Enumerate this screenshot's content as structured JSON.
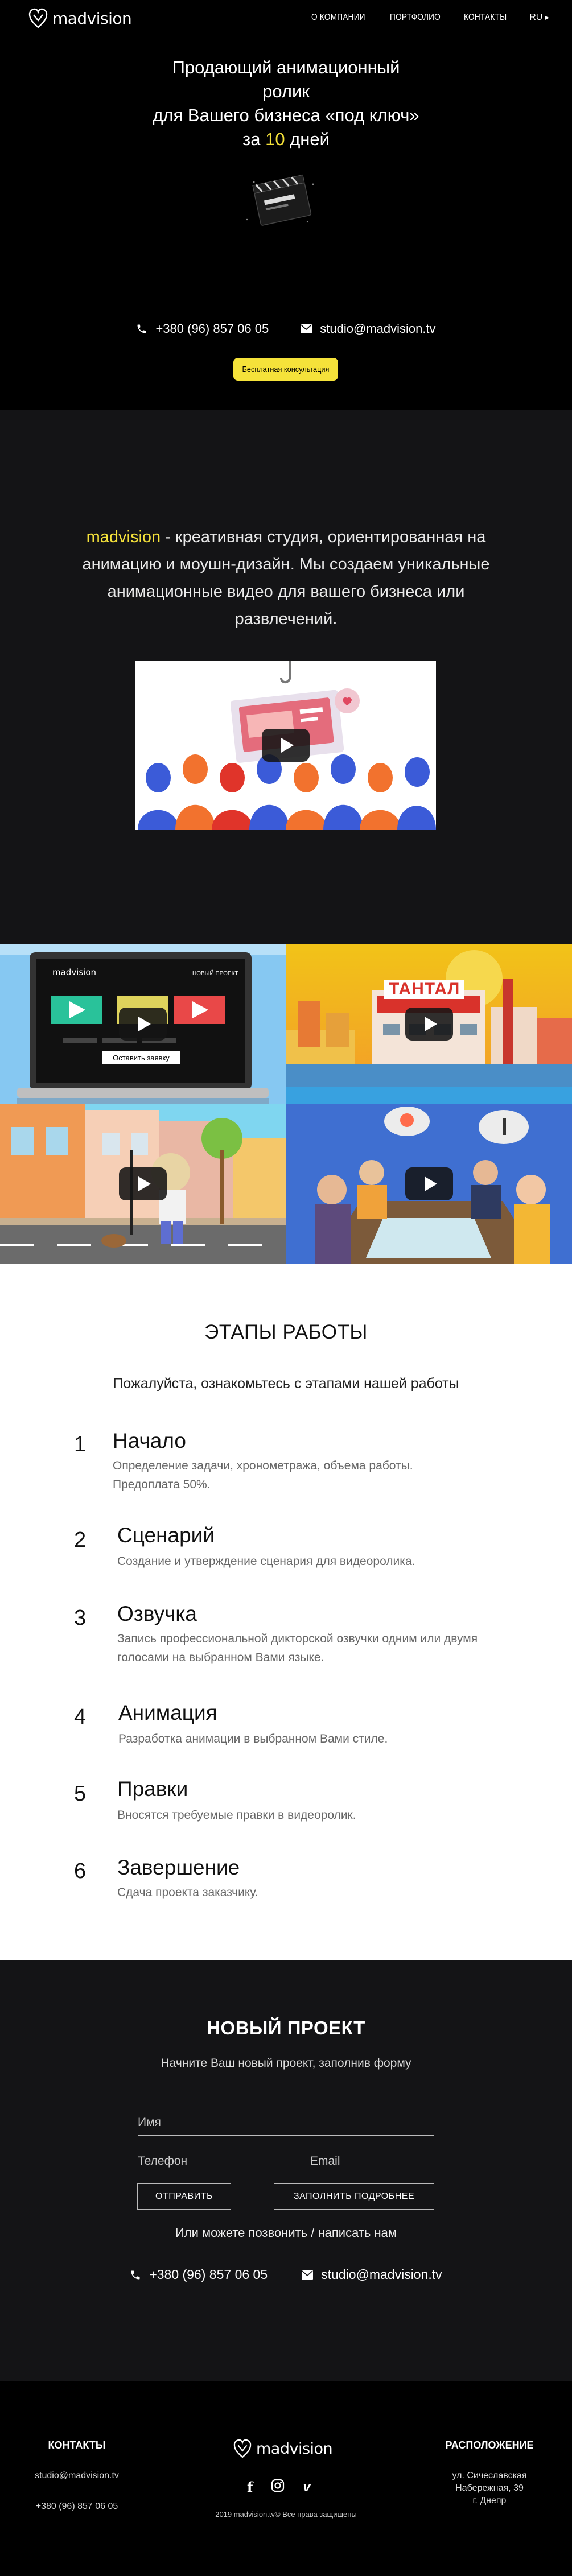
{
  "header": {
    "brand": "madvision",
    "nav": [
      "О КОМПАНИИ",
      "ПОРТФОЛИО",
      "КОНТАКТЫ"
    ],
    "lang": "RU"
  },
  "hero": {
    "title_line1": "Продающий анимационный",
    "title_line2": "ролик",
    "title_line3": "для Вашего бизнеса «под ключ»",
    "title_prefix": "за",
    "title_number": "10",
    "title_suffix": "дней",
    "phone": "+380 (96) 857 06 05",
    "email": "studio@madvision.tv",
    "cta": "Бесплатная консультация"
  },
  "about": {
    "brand": "madvision",
    "text": " - креативная студия, ориентированная на анимацию и моушн-дизайн. Мы создаем уникальные анимационные видео для вашего бизнеса или развлечений."
  },
  "portfolio": {
    "tile1_brand": "madvision",
    "tile1_label": "НОВЫЙ ПРОЕКТ",
    "tile1_button": "Оставить заявку",
    "tile2_sign": "ТАНТАЛ"
  },
  "stages": {
    "title": "ЭТАПЫ РАБОТЫ",
    "subtitle": "Пожалуйста, ознакомьтесь с этапами нашей работы",
    "items": [
      {
        "num": "1",
        "title": "Начало",
        "desc": "Определение задачи, хронометража, объема работы. Предоплата 50%."
      },
      {
        "num": "2",
        "title": "Сценарий",
        "desc": "Создание и утверждение сценария для видеоролика."
      },
      {
        "num": "3",
        "title": "Озвучка",
        "desc": "Запись профессиональной дикторской озвучки одним или двумя голосами на выбранном Вами языке."
      },
      {
        "num": "4",
        "title": "Анимация",
        "desc": "Разработка анимации в выбранном Вами стиле."
      },
      {
        "num": "5",
        "title": "Правки",
        "desc": "Вносятся требуемые правки в видеоролик."
      },
      {
        "num": "6",
        "title": "Завершение",
        "desc": "Сдача проекта заказчику."
      }
    ]
  },
  "project": {
    "title": "НОВЫЙ ПРОЕКТ",
    "subtitle": "Начните Ваш новый проект, заполнив форму",
    "name_placeholder": "Имя",
    "phone_placeholder": "Телефон",
    "email_placeholder": "Email",
    "send_button": "ОТПРАВИТЬ",
    "details_button": "ЗАПОЛНИТЬ ПОДРОБНЕЕ",
    "alt_text": "Или можете позвонить / написать нам",
    "phone": "+380 (96) 857 06 05",
    "email": "studio@madvision.tv"
  },
  "footer": {
    "contacts_title": "КОНТАКТЫ",
    "email": "studio@madvision.tv",
    "phone": "+380 (96) 857 06 05",
    "brand": "madvision",
    "copyright": "2019 madvision.tv© Все права защищены",
    "location_title": "РАСПОЛОЖЕНИЕ",
    "address_line1": "ул. Сичеславская",
    "address_line2": "Набережная, 39",
    "address_line3": "г. Днепр"
  },
  "colors": {
    "accent": "#f5e23a",
    "dark_bg": "#141416",
    "black": "#000000",
    "white": "#ffffff"
  }
}
